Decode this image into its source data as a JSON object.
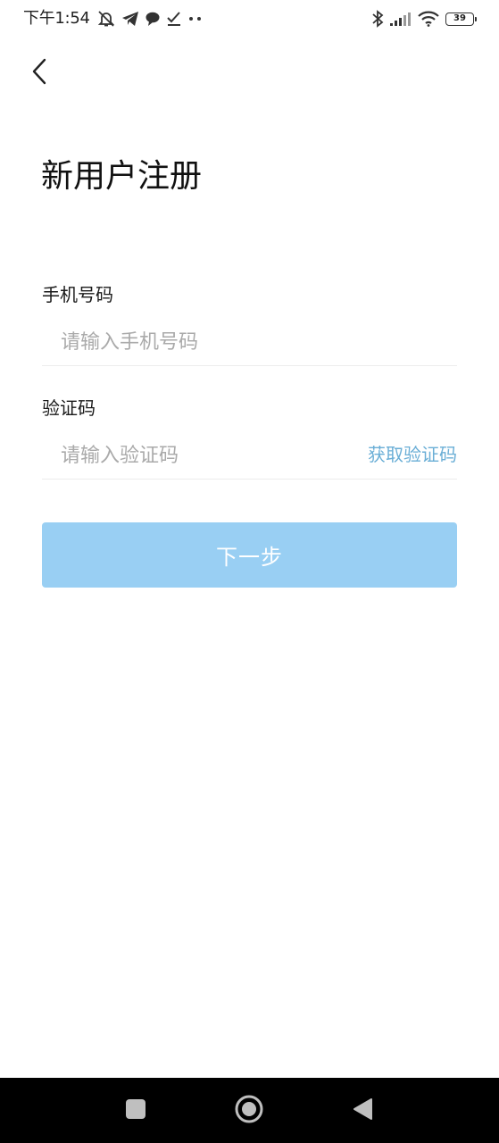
{
  "status_bar": {
    "time": "下午1:54",
    "icons_left": [
      "mute-bell-icon",
      "telegram-icon",
      "chat-bubble-icon",
      "check-icon",
      "more-dots-icon"
    ],
    "icons_right": [
      "bluetooth-icon",
      "signal-icon",
      "wifi-icon",
      "battery-icon"
    ],
    "battery_level": "39"
  },
  "header": {
    "back_icon": "chevron-left-icon",
    "title": "新用户注册"
  },
  "form": {
    "phone": {
      "label": "手机号码",
      "placeholder": "请输入手机号码",
      "value": ""
    },
    "code": {
      "label": "验证码",
      "placeholder": "请输入验证码",
      "value": "",
      "get_code_label": "获取验证码"
    },
    "next_label": "下一步"
  },
  "colors": {
    "accent_link": "#6aaed6",
    "button_disabled": "#99cff3",
    "nav_bar": "#000000"
  },
  "nav_bar": {
    "buttons": [
      "recents-square-icon",
      "home-circle-icon",
      "back-triangle-icon"
    ]
  }
}
